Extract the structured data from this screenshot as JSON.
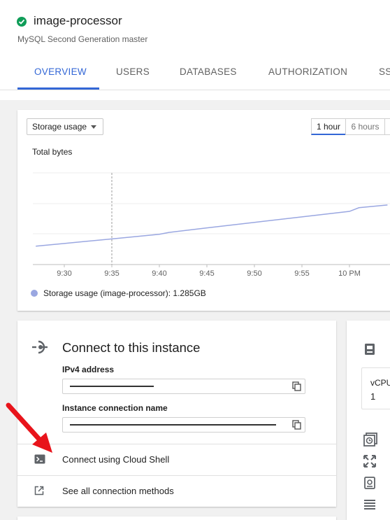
{
  "instance": {
    "name": "image-processor",
    "subtitle": "MySQL Second Generation master",
    "status_color": "#0f9d58"
  },
  "tabs": [
    {
      "label": "OVERVIEW",
      "active": true
    },
    {
      "label": "USERS",
      "active": false
    },
    {
      "label": "DATABASES",
      "active": false
    },
    {
      "label": "AUTHORIZATION",
      "active": false
    },
    {
      "label": "SS",
      "active": false
    }
  ],
  "chart_card": {
    "metric_select": "Storage usage",
    "ranges": [
      "1 hour",
      "6 hours"
    ],
    "active_range": "1 hour",
    "legend": "Storage usage (image-processor): 1.285GB"
  },
  "chart_data": {
    "type": "line",
    "title": "Total bytes",
    "xlabel": "",
    "ylabel": "",
    "x_ticks": [
      "9:30",
      "9:35",
      "9:40",
      "9:45",
      "9:50",
      "9:55",
      "10 PM"
    ],
    "series": [
      {
        "name": "Storage usage (image-processor): 1.285GB",
        "color": "#9aa7e1",
        "x": [
          "9:27",
          "9:30",
          "9:35",
          "9:40",
          "9:41",
          "9:45",
          "9:50",
          "9:55",
          "10 PM",
          "10:01",
          "10:04"
        ],
        "y": [
          0.2,
          0.23,
          0.28,
          0.33,
          0.35,
          0.4,
          0.46,
          0.52,
          0.58,
          0.62,
          0.65
        ]
      }
    ],
    "cursor_x": "9:35",
    "grid": true
  },
  "connect_card": {
    "title": "Connect to this instance",
    "ipv4_label": "IPv4 address",
    "connection_name_label": "Instance connection name",
    "actions": [
      {
        "label": "Connect using Cloud Shell",
        "icon": "terminal-icon"
      },
      {
        "label": "See all connection methods",
        "icon": "open-in-new-icon"
      }
    ]
  },
  "config_card": {
    "vcpu_label": "vCPU",
    "vcpu_value": "1"
  },
  "annotation": {
    "arrow_color": "#e8141b"
  }
}
